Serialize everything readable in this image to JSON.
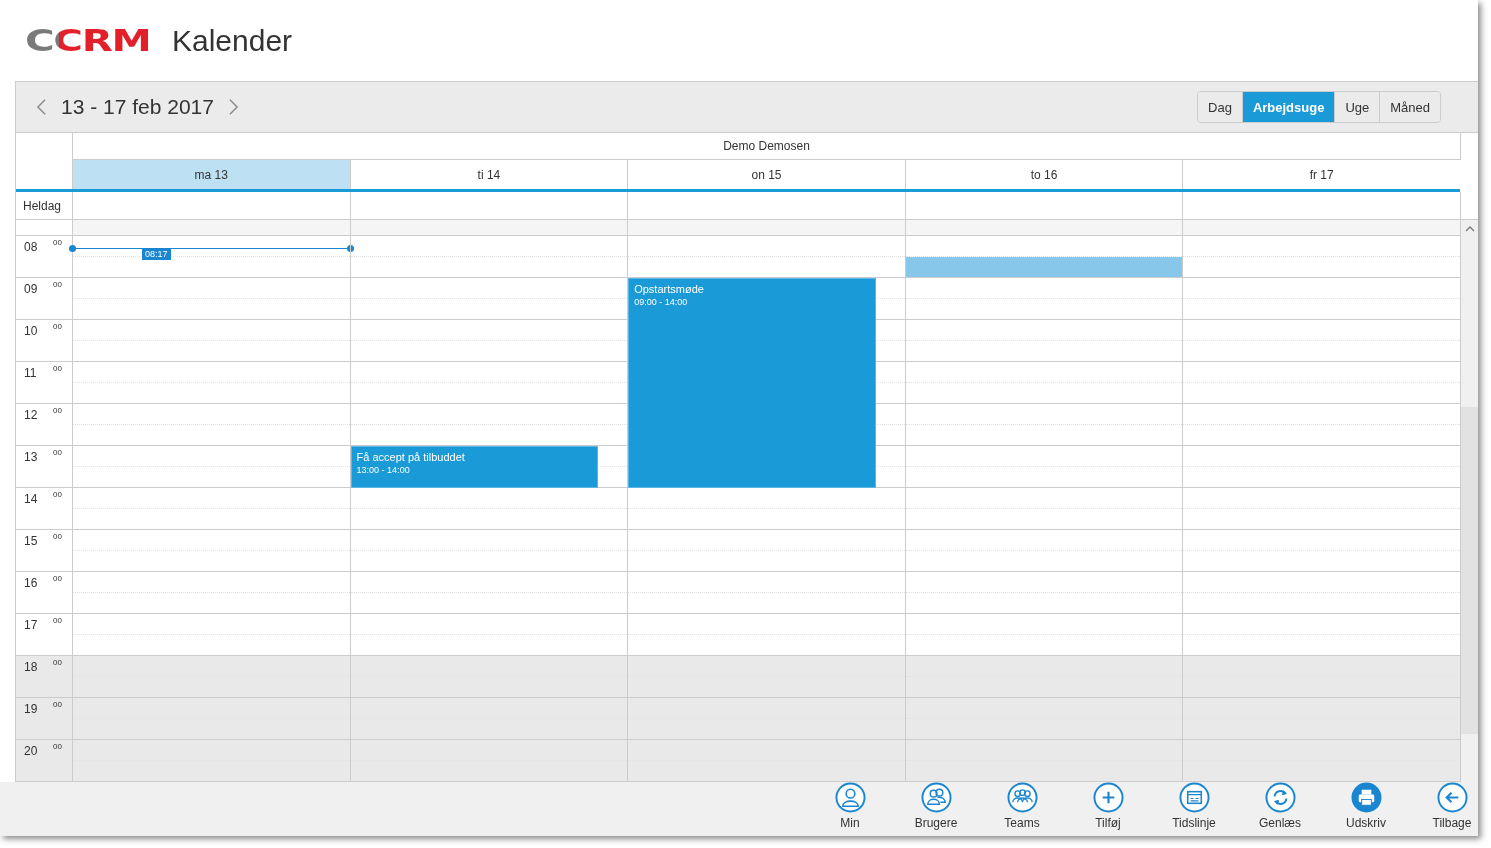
{
  "header": {
    "brand": "CCRM",
    "title": "Kalender"
  },
  "toolbar": {
    "date_range": "13 - 17 feb 2017",
    "views": [
      {
        "label": "Dag",
        "selected": false
      },
      {
        "label": "Arbejdsuge",
        "selected": true
      },
      {
        "label": "Uge",
        "selected": false
      },
      {
        "label": "Måned",
        "selected": false
      }
    ]
  },
  "calendar": {
    "resource": "Demo Demosen",
    "allday_label": "Heldag",
    "days": [
      {
        "label": "ma 13",
        "selected": true,
        "now_marker": "08:17"
      },
      {
        "label": "ti 14",
        "selected": false,
        "events": [
          {
            "title": "Få accept på tilbuddet",
            "time": "13:00 - 14:00"
          }
        ]
      },
      {
        "label": "on 15",
        "selected": false,
        "events": [
          {
            "title": "Opstartsmøde",
            "time": "09:00 - 14:00"
          }
        ]
      },
      {
        "label": "to 16",
        "selected": false
      },
      {
        "label": "fr 17",
        "selected": false
      }
    ],
    "hours": [
      {
        "hour": "08",
        "minutes": "00",
        "off_hours": false,
        "second_half_selected": [
          false,
          false,
          false,
          true,
          false
        ]
      },
      {
        "hour": "09",
        "minutes": "00",
        "off_hours": false
      },
      {
        "hour": "10",
        "minutes": "00",
        "off_hours": false
      },
      {
        "hour": "11",
        "minutes": "00",
        "off_hours": false
      },
      {
        "hour": "12",
        "minutes": "00",
        "off_hours": false
      },
      {
        "hour": "13",
        "minutes": "00",
        "off_hours": false
      },
      {
        "hour": "14",
        "minutes": "00",
        "off_hours": false
      },
      {
        "hour": "15",
        "minutes": "00",
        "off_hours": false
      },
      {
        "hour": "16",
        "minutes": "00",
        "off_hours": false
      },
      {
        "hour": "17",
        "minutes": "00",
        "off_hours": false
      },
      {
        "hour": "18",
        "minutes": "00",
        "off_hours": true
      },
      {
        "hour": "19",
        "minutes": "00",
        "off_hours": true
      },
      {
        "hour": "20",
        "minutes": "00",
        "off_hours": true
      }
    ]
  },
  "bottom_bar": [
    {
      "label": "Min",
      "kind": "person"
    },
    {
      "label": "Brugere",
      "kind": "users"
    },
    {
      "label": "Teams",
      "kind": "teams"
    },
    {
      "label": "Tilføj",
      "kind": "add"
    },
    {
      "label": "Tidslinje",
      "kind": "timeline"
    },
    {
      "label": "Genlæs",
      "kind": "reload"
    },
    {
      "label": "Udskriv",
      "kind": "print"
    },
    {
      "label": "Tilbage",
      "kind": "back"
    }
  ]
}
